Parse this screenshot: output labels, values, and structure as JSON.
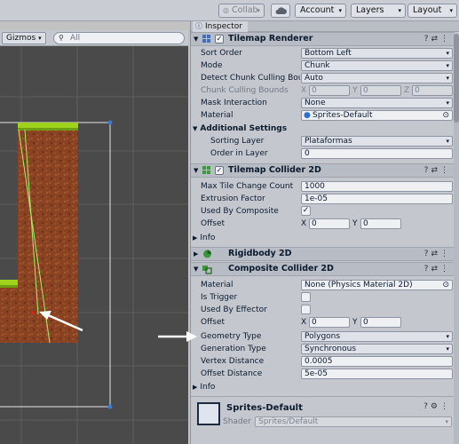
{
  "toolbar": {
    "collab": "Collab",
    "account": "Account",
    "layers": "Layers",
    "layout": "Layout"
  },
  "scene": {
    "gizmos": "Gizmos",
    "search_placeholder": "All"
  },
  "inspector": {
    "tab": "Inspector",
    "tilemap_renderer": {
      "title": "Tilemap Renderer",
      "sort_order_label": "Sort Order",
      "sort_order": "Bottom Left",
      "mode_label": "Mode",
      "mode": "Chunk",
      "detect_label": "Detect Chunk Culling Bounds",
      "detect": "Auto",
      "bounds_label": "Chunk Culling Bounds",
      "bounds_x": "0",
      "bounds_y": "0",
      "bounds_z": "0",
      "mask_label": "Mask Interaction",
      "mask": "None",
      "material_label": "Material",
      "material": "Sprites-Default",
      "additional_label": "Additional Settings",
      "sorting_layer_label": "Sorting Layer",
      "sorting_layer": "Plataformas",
      "order_label": "Order in Layer",
      "order": "0"
    },
    "tilemap_collider": {
      "title": "Tilemap Collider 2D",
      "max_tile_label": "Max Tile Change Count",
      "max_tile": "1000",
      "extrusion_label": "Extrusion Factor",
      "extrusion": "1e-05",
      "used_composite_label": "Used By Composite",
      "used_composite_checked": true,
      "offset_label": "Offset",
      "offset_x": "0",
      "offset_y": "0",
      "info_label": "Info"
    },
    "rigidbody": {
      "title": "Rigidbody 2D"
    },
    "composite_collider": {
      "title": "Composite Collider 2D",
      "material_label": "Material",
      "material": "None (Physics Material 2D)",
      "trigger_label": "Is Trigger",
      "effector_label": "Used By Effector",
      "offset_label": "Offset",
      "offset_x": "0",
      "offset_y": "0",
      "geometry_label": "Geometry Type",
      "geometry": "Polygons",
      "generation_label": "Generation Type",
      "generation": "Synchronous",
      "vertex_label": "Vertex Distance",
      "vertex": "0.0005",
      "offset_distance_label": "Offset Distance",
      "offset_distance": "5e-05",
      "info_label": "Info"
    },
    "sprite_material": {
      "title": "Sprites-Default",
      "shader_label": "Shader",
      "shader": "Sprites/Default"
    }
  },
  "colors": {
    "scene_bg": "#4a4a4a",
    "grass": "#9ed21c",
    "dirt": "#8a4322",
    "inspector_bg": "#c4c8ce",
    "annotation_arrow": "#ffffff"
  }
}
